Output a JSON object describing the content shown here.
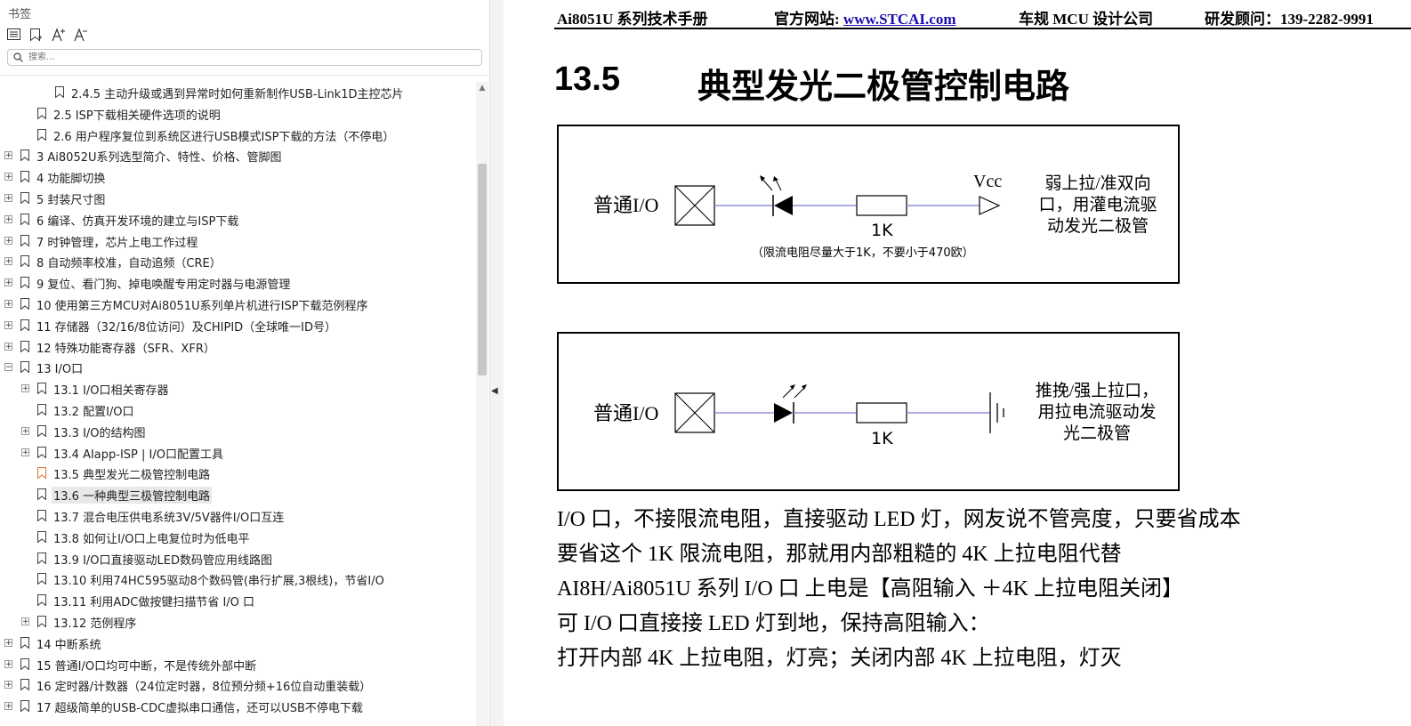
{
  "sidebar": {
    "title": "书签",
    "search_placeholder": "搜索...",
    "tools": [
      "list-icon",
      "bookmark-add-icon",
      "font-increase-icon",
      "font-decrease-icon"
    ],
    "items": [
      {
        "label": "2.4.5  主动升级或遇到异常时如何重新制作USB-Link1D主控芯片",
        "level": 2,
        "expand": false
      },
      {
        "label": "2.5  ISP下载相关硬件选项的说明",
        "level": 1,
        "expand": false
      },
      {
        "label": "2.6  用户程序复位到系统区进行USB模式ISP下载的方法（不停电）",
        "level": 1,
        "expand": false
      },
      {
        "label": "3  Ai8052U系列选型简介、特性、价格、管脚图",
        "level": 0,
        "expand": true
      },
      {
        "label": "4  功能脚切换",
        "level": 0,
        "expand": true
      },
      {
        "label": "5  封装尺寸图",
        "level": 0,
        "expand": true
      },
      {
        "label": "6  编译、仿真开发环境的建立与ISP下载",
        "level": 0,
        "expand": true
      },
      {
        "label": "7  时钟管理，芯片上电工作过程",
        "level": 0,
        "expand": true
      },
      {
        "label": "8  自动频率校准，自动追频（CRE）",
        "level": 0,
        "expand": true
      },
      {
        "label": "9  复位、看门狗、掉电唤醒专用定时器与电源管理",
        "level": 0,
        "expand": true
      },
      {
        "label": "10  使用第三方MCU对Ai8051U系列单片机进行ISP下载范例程序",
        "level": 0,
        "expand": true
      },
      {
        "label": "11  存储器（32/16/8位访问）及CHIPID（全球唯一ID号）",
        "level": 0,
        "expand": true
      },
      {
        "label": "12  特殊功能寄存器（SFR、XFR）",
        "level": 0,
        "expand": true
      },
      {
        "label": "13  I/O口",
        "level": 0,
        "expand": "open"
      },
      {
        "label": "13.1 I/O口相关寄存器",
        "level": 1,
        "expand": true
      },
      {
        "label": "13.2  配置I/O口",
        "level": 1,
        "expand": false
      },
      {
        "label": "13.3  I/O的结构图",
        "level": 1,
        "expand": true
      },
      {
        "label": "13.4  AIapp-ISP | I/O口配置工具",
        "level": 1,
        "expand": true
      },
      {
        "label": "13.5  典型发光二极管控制电路",
        "level": 1,
        "expand": false,
        "active": true
      },
      {
        "label": "13.6  一种典型三极管控制电路",
        "level": 1,
        "expand": false,
        "highlight": true
      },
      {
        "label": "13.7  混合电压供电系统3V/5V器件I/O口互连",
        "level": 1,
        "expand": false
      },
      {
        "label": "13.8  如何让I/O口上电复位时为低电平",
        "level": 1,
        "expand": false
      },
      {
        "label": "13.9  I/O口直接驱动LED数码管应用线路图",
        "level": 1,
        "expand": false
      },
      {
        "label": "13.10  利用74HC595驱动8个数码管(串行扩展,3根线)，节省I/O",
        "level": 1,
        "expand": false
      },
      {
        "label": "13.11  利用ADC做按键扫描节省 I/O 口",
        "level": 1,
        "expand": false
      },
      {
        "label": "13.12  范例程序",
        "level": 1,
        "expand": true
      },
      {
        "label": "14  中断系统",
        "level": 0,
        "expand": true
      },
      {
        "label": "15  普通I/O口均可中断，不是传统外部中断",
        "level": 0,
        "expand": true
      },
      {
        "label": "16  定时器/计数器（24位定时器，8位预分频+16位自动重装载）",
        "level": 0,
        "expand": true
      },
      {
        "label": "17  超级简单的USB-CDC虚拟串口通信，还可以USB不停电下载",
        "level": 0,
        "expand": true
      }
    ]
  },
  "header": {
    "manual": "Ai8051U 系列技术手册",
    "site_label": "官方网站: ",
    "site_url": "www.STCAI.com",
    "company": "车规 MCU 设计公司",
    "advisor": "研发顾问：139-2282-9991"
  },
  "section": {
    "number": "13.5",
    "title": "典型发光二极管控制电路"
  },
  "figure1": {
    "io_label": "普通I/O",
    "resistor_label": "1K",
    "vcc_label": "Vcc",
    "note": "（限流电阻尽量大于1K，不要小于470欧）",
    "desc": [
      "弱上拉/准双向",
      "口，用灌电流驱",
      "动发光二极管"
    ]
  },
  "figure2": {
    "io_label": "普通I/O",
    "resistor_label": "1K",
    "desc": [
      "推挽/强上拉口，",
      "用拉电流驱动发",
      "光二极管"
    ]
  },
  "body": [
    "I/O 口，不接限流电阻，直接驱动 LED 灯，网友说不管亮度，只要省成本",
    "要省这个 1K 限流电阻，那就用内部粗糙的 4K 上拉电阻代替",
    "AI8H/Ai8051U 系列  I/O 口  上电是【高阻输入 ＋4K 上拉电阻关闭】",
    "可 I/O 口直接接 LED 灯到地，保持高阻输入：",
    "打开内部 4K 上拉电阻，灯亮；关闭内部 4K 上拉电阻，灯灭"
  ],
  "colors": {
    "wire": "#7b7bd6",
    "bookmark_active": "#e07a3a",
    "link": "#1a0dab"
  }
}
